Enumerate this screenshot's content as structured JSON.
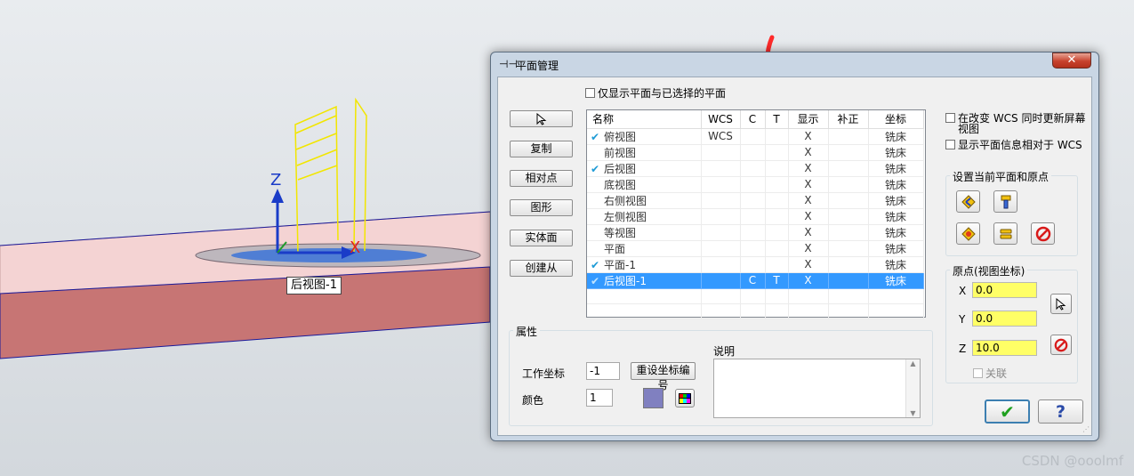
{
  "viewport": {
    "tooltip": "后视图-1",
    "axis_z": "Z",
    "axis_x": "X",
    "watermark": "CSDN @ooolmf"
  },
  "dialog": {
    "title": "平面管理",
    "close_glyph": "✕",
    "show_only_checkbox": "仅显示平面与已选择的平面",
    "side_buttons": [
      "",
      "复制",
      "相对点",
      "图形",
      "实体面",
      "创建从"
    ],
    "table": {
      "headers": [
        "名称",
        "WCS",
        "C",
        "T",
        "显示",
        "补正",
        "坐标"
      ],
      "rows": [
        {
          "checked": true,
          "name": "俯视图",
          "wcs": "WCS",
          "c": "",
          "t": "",
          "show": "X",
          "comp": "",
          "coord": "铣床",
          "selected": false
        },
        {
          "checked": false,
          "name": "前视图",
          "wcs": "",
          "c": "",
          "t": "",
          "show": "X",
          "comp": "",
          "coord": "铣床",
          "selected": false
        },
        {
          "checked": true,
          "name": "后视图",
          "wcs": "",
          "c": "",
          "t": "",
          "show": "X",
          "comp": "",
          "coord": "铣床",
          "selected": false
        },
        {
          "checked": false,
          "name": "底视图",
          "wcs": "",
          "c": "",
          "t": "",
          "show": "X",
          "comp": "",
          "coord": "铣床",
          "selected": false
        },
        {
          "checked": false,
          "name": "右侧视图",
          "wcs": "",
          "c": "",
          "t": "",
          "show": "X",
          "comp": "",
          "coord": "铣床",
          "selected": false
        },
        {
          "checked": false,
          "name": "左侧视图",
          "wcs": "",
          "c": "",
          "t": "",
          "show": "X",
          "comp": "",
          "coord": "铣床",
          "selected": false
        },
        {
          "checked": false,
          "name": "等视图",
          "wcs": "",
          "c": "",
          "t": "",
          "show": "X",
          "comp": "",
          "coord": "铣床",
          "selected": false
        },
        {
          "checked": false,
          "name": "平面",
          "wcs": "",
          "c": "",
          "t": "",
          "show": "X",
          "comp": "",
          "coord": "铣床",
          "selected": false
        },
        {
          "checked": true,
          "name": "平面-1",
          "wcs": "",
          "c": "",
          "t": "",
          "show": "X",
          "comp": "",
          "coord": "铣床",
          "selected": false
        },
        {
          "checked": true,
          "name": "后视图-1",
          "wcs": "",
          "c": "C",
          "t": "T",
          "show": "X",
          "comp": "",
          "coord": "铣床",
          "selected": true
        }
      ]
    },
    "properties": {
      "title": "属性",
      "work_coord_label": "工作坐标",
      "work_coord_value": "-1",
      "reset_button": "重设坐标编号",
      "color_label": "颜色",
      "color_value": "1",
      "color_swatch": "#8080c0",
      "description_label": "说明"
    },
    "right": {
      "update_view_checkbox": "在改变 WCS 同时更新屏幕视图",
      "relative_info_checkbox": "显示平面信息相对于 WCS",
      "set_plane_group": "设置当前平面和原点",
      "origin_group": "原点(视图坐标)",
      "x_label": "X",
      "x_value": "0.0",
      "y_label": "Y",
      "y_value": "0.0",
      "z_label": "Z",
      "z_value": "10.0",
      "link_checkbox": "关联"
    },
    "ok_glyph": "✔",
    "help_glyph": "?"
  },
  "colors": {
    "accent": "#3399ff",
    "coord_field": "#ffff66",
    "check": "#1e9bd6"
  }
}
